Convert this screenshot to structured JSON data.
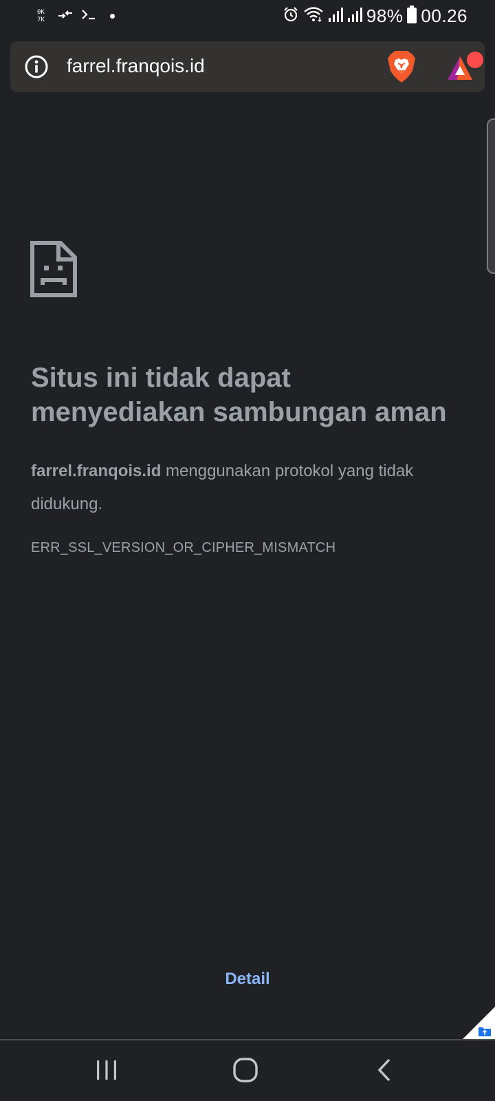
{
  "status_bar": {
    "battery": "98%",
    "time": "00.26",
    "icons": [
      "keyboard-speed-icon",
      "data-transfer-icon",
      "terminal-icon",
      "notification-dot-icon",
      "alarm-icon",
      "wifi-icon",
      "signal-icon",
      "signal-icon",
      "battery-icon"
    ]
  },
  "address_bar": {
    "url": "farrel.franqois.id",
    "icons": [
      "info-icon",
      "brave-shields-icon",
      "brave-rewards-icon"
    ]
  },
  "error": {
    "icon": "sad-page-icon",
    "title": "Situs ini tidak dapat menyediakan sambungan aman",
    "domain": "farrel.franqois.id",
    "message": " menggunakan protokol yang tidak didukung.",
    "code": "ERR_SSL_VERSION_OR_CIPHER_MISMATCH",
    "detail_label": "Detail"
  },
  "nav_bar": {
    "icons": [
      "recents-icon",
      "home-icon",
      "back-icon"
    ]
  },
  "colors": {
    "background": "#202124",
    "text": "#9aa0a6",
    "link": "#8ab4f8",
    "brave_orange": "#f25a2b",
    "rewards_red": "#ff4b4b"
  }
}
